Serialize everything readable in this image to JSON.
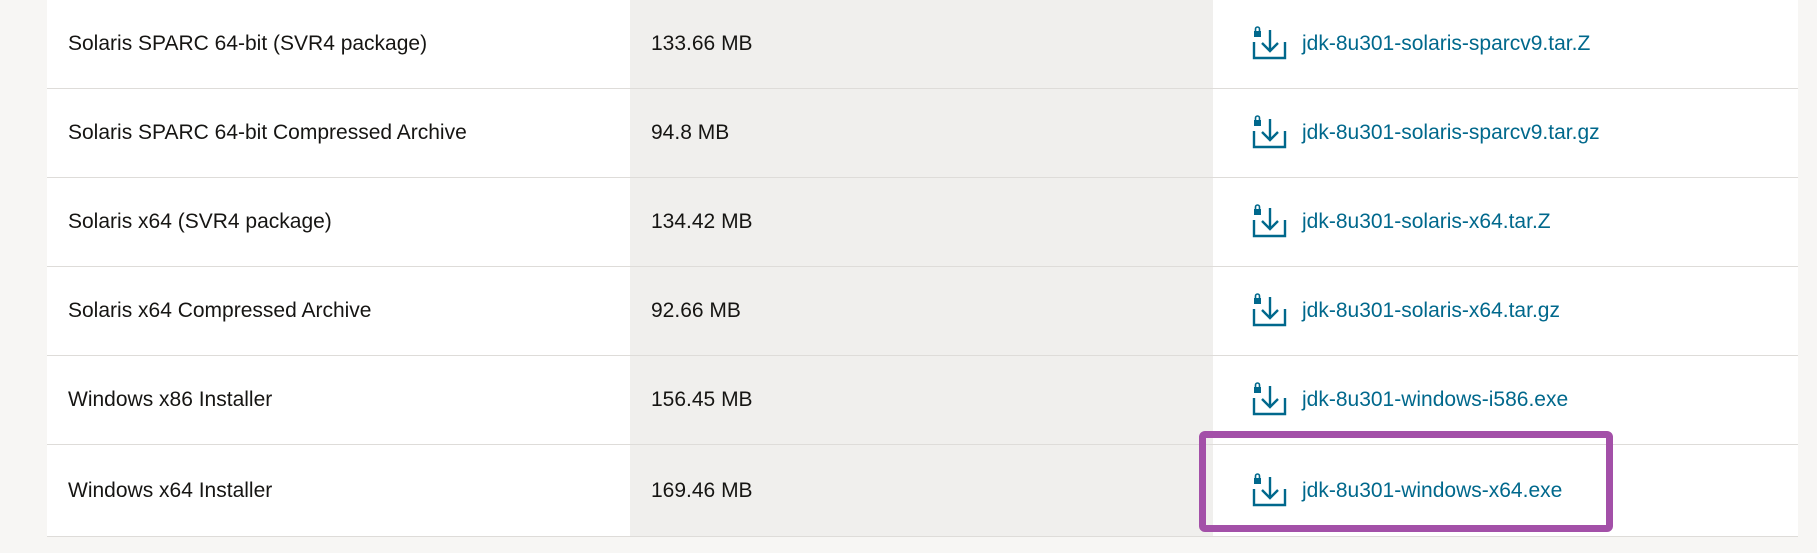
{
  "table": {
    "rows": [
      {
        "product": "Solaris SPARC 64-bit (SVR4 package)",
        "size": "133.66 MB",
        "file": "jdk-8u301-solaris-sparcv9.tar.Z"
      },
      {
        "product": "Solaris SPARC 64-bit Compressed Archive",
        "size": "94.8 MB",
        "file": "jdk-8u301-solaris-sparcv9.tar.gz"
      },
      {
        "product": "Solaris x64 (SVR4 package)",
        "size": "134.42 MB",
        "file": "jdk-8u301-solaris-x64.tar.Z"
      },
      {
        "product": "Solaris x64 Compressed Archive",
        "size": "92.66 MB",
        "file": "jdk-8u301-solaris-x64.tar.gz"
      },
      {
        "product": "Windows x86 Installer",
        "size": "156.45 MB",
        "file": "jdk-8u301-windows-i586.exe"
      },
      {
        "product": "Windows x64 Installer",
        "size": "169.46 MB",
        "file": "jdk-8u301-windows-x64.exe"
      }
    ]
  },
  "icons": {
    "download": "download-lock-icon"
  },
  "colors": {
    "link": "#00688c",
    "highlight": "#a350a8",
    "size_column_bg": "#f0efed",
    "row_border": "#dedcd9"
  }
}
